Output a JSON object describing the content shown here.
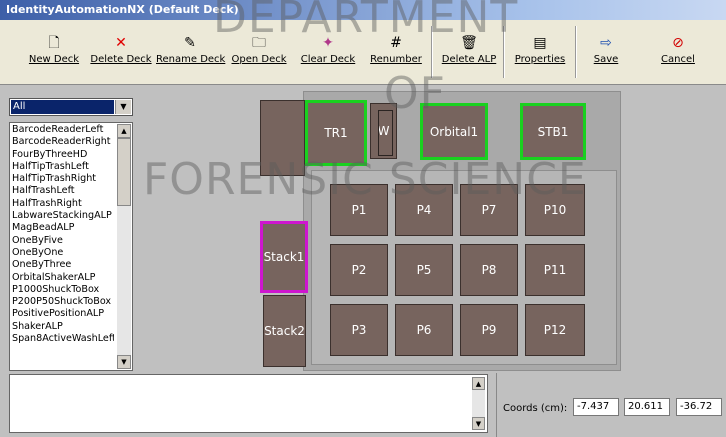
{
  "window": {
    "title": "IdentityAutomationNX (Default Deck)"
  },
  "toolbar": {
    "buttons": [
      {
        "label": "New Deck",
        "icon": "new-deck-icon",
        "glyph": "🗋"
      },
      {
        "label": "Delete Deck",
        "icon": "delete-deck-icon",
        "glyph": "✕"
      },
      {
        "label": "Rename Deck",
        "icon": "rename-deck-icon",
        "glyph": "✎"
      },
      {
        "label": "Open Deck",
        "icon": "open-deck-icon",
        "glyph": "🗀"
      },
      {
        "label": "Clear Deck",
        "icon": "clear-deck-icon",
        "glyph": "✦"
      },
      {
        "label": "Renumber",
        "icon": "renumber-icon",
        "glyph": "#"
      },
      {
        "label": "Delete ALP",
        "icon": "delete-alp-icon",
        "glyph": "🗑"
      },
      {
        "label": "Properties",
        "icon": "properties-icon",
        "glyph": "▤"
      },
      {
        "label": "Save",
        "icon": "save-icon",
        "glyph": "⇨"
      },
      {
        "label": "Cancel",
        "icon": "cancel-icon",
        "glyph": "⊘"
      }
    ]
  },
  "watermark": {
    "line1": "DEPARTMENT",
    "line2": "OF",
    "line3": "FORENSIC SCIENCE"
  },
  "deck_select": {
    "value": "All"
  },
  "alp_list": {
    "items": [
      "BarcodeReaderLeft",
      "BarcodeReaderRight",
      "FourByThreeHD",
      "HalfTipTrashLeft",
      "HalfTipTrashRight",
      "HalfTrashLeft",
      "HalfTrashRight",
      "LabwareStackingALP",
      "MagBeadALP",
      "OneByFive",
      "OneByOne",
      "OneByThree",
      "OrbitalShakerALP",
      "P1000ShuckToBox",
      "P200P50ShuckToBox",
      "PositivePositionALP",
      "ShakerALP",
      "Span8ActiveWashLeft"
    ]
  },
  "deck": {
    "tr1": "TR1",
    "w": "W",
    "orbital1": "Orbital1",
    "stb1": "STB1",
    "stack1": "Stack1",
    "stack2": "Stack2",
    "plates": [
      "P1",
      "P4",
      "P7",
      "P10",
      "P2",
      "P5",
      "P8",
      "P11",
      "P3",
      "P6",
      "P9",
      "P12"
    ],
    "colors": {
      "plate": "#77645e",
      "selected_green": "#19d11f",
      "selected_magenta": "#ce16cf"
    }
  },
  "coords": {
    "label": "Coords (cm):",
    "x": "-7.437",
    "y": "20.611",
    "z": "-36.72"
  }
}
